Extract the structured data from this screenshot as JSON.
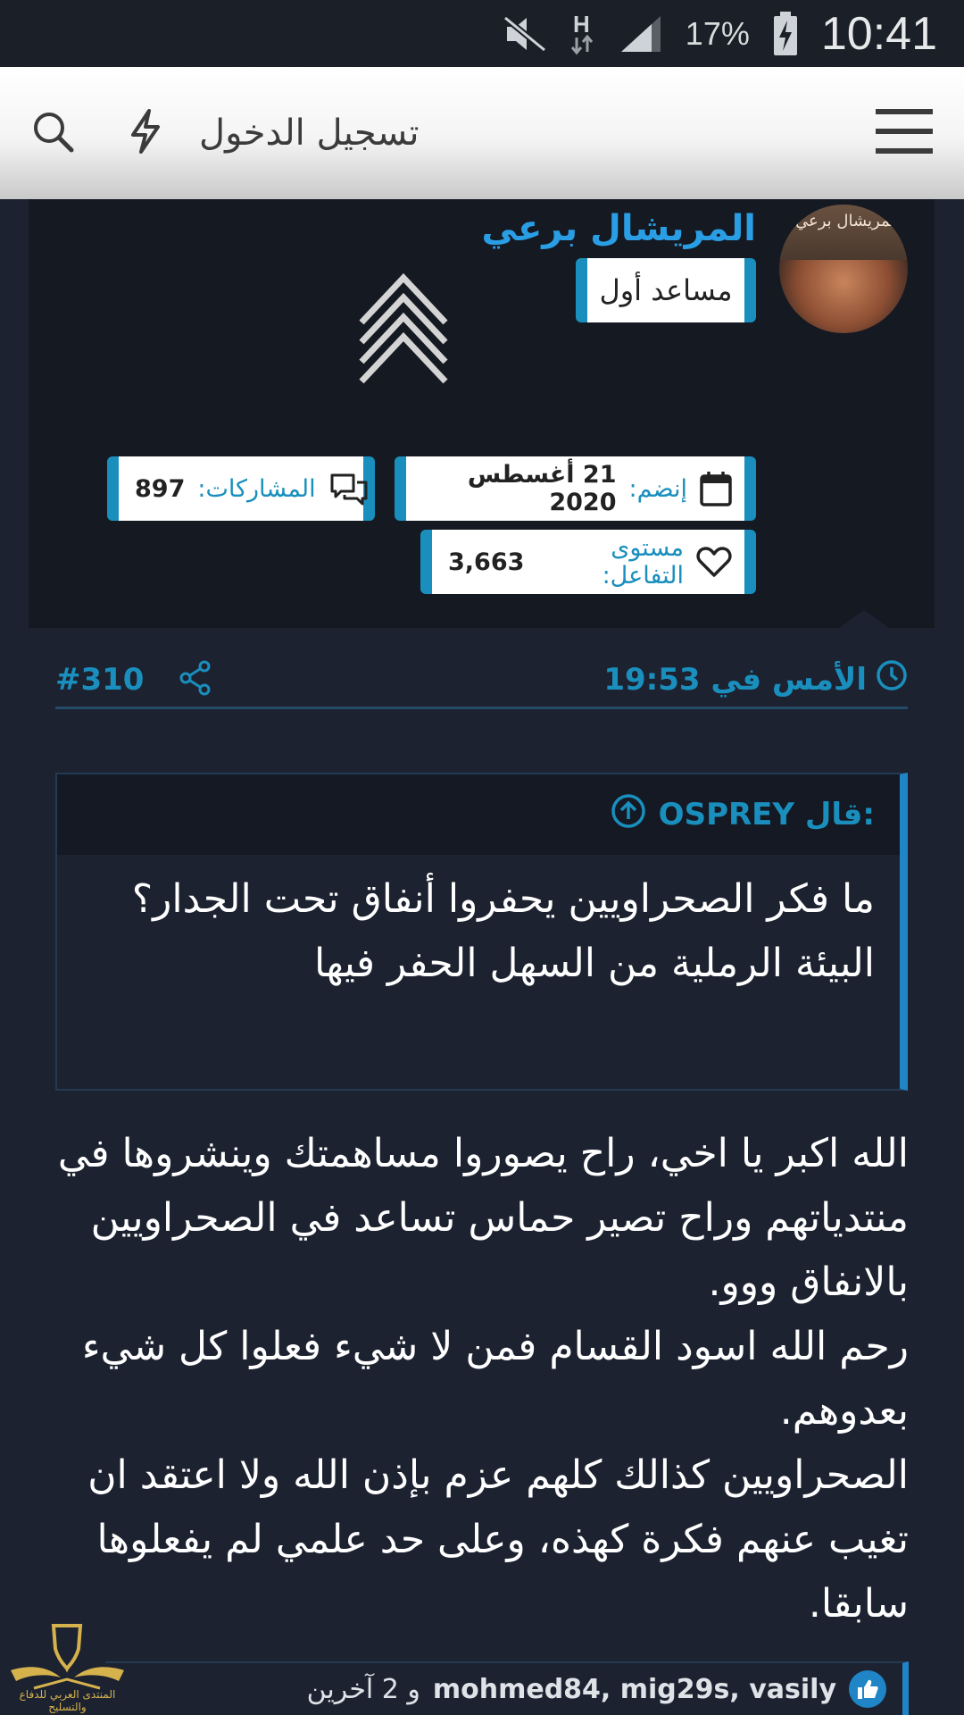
{
  "status_bar": {
    "time": "10:41",
    "battery": "17%",
    "icons": [
      "mute-icon",
      "data-arrows-icon",
      "signal-icon",
      "battery-charging-icon"
    ]
  },
  "app_bar": {
    "login_label": "تسجيل الدخول",
    "icons": [
      "search-icon",
      "lightning-icon",
      "hamburger-menu-icon"
    ]
  },
  "profile": {
    "avatar_caption": "المريشال برعي",
    "username": "المريشال برعي",
    "rank": "مساعد أول",
    "joined_label": "إنضم:",
    "joined_value": "21 أغسطس 2020",
    "posts_label": "المشاركات:",
    "posts_value": "897",
    "reaction_label": "مستوى التفاعل:",
    "reaction_value": "3,663"
  },
  "post": {
    "number": "#310",
    "time": "الأمس في 19:53",
    "quote": {
      "author_said": "OSPREY قال:",
      "lines": [
        "ما فكر الصحراويين يحفروا أنفاق تحت الجدار؟",
        "البيئة الرملية من السهل الحفر فيها"
      ]
    },
    "body_paragraphs": [
      "الله اكبر يا اخي، راح يصوروا مساهمتك وينشروها في منتدياتهم وراح تصير حماس تساعد في الصحراويين بالانفاق ووو.",
      "رحم الله اسود القسام فمن لا شيء فعلوا كل شيء بعدوهم.",
      "الصحراويين كذالك كلهم عزم بإذن الله ولا اعتقد ان تغيب عنهم فكرة كهذه، وعلى حد علمي لم يفعلوها سابقا."
    ],
    "reactions": {
      "names": "mohmed84, mig29s, vasily",
      "others": "و 2 آخرين"
    }
  },
  "watermark": {
    "text": "المنتدى العربي للدفاع والتسليح"
  },
  "colors": {
    "accent": "#1a8fbd",
    "link": "#2a9ee4",
    "background": "#1c2230",
    "card": "#141922"
  }
}
